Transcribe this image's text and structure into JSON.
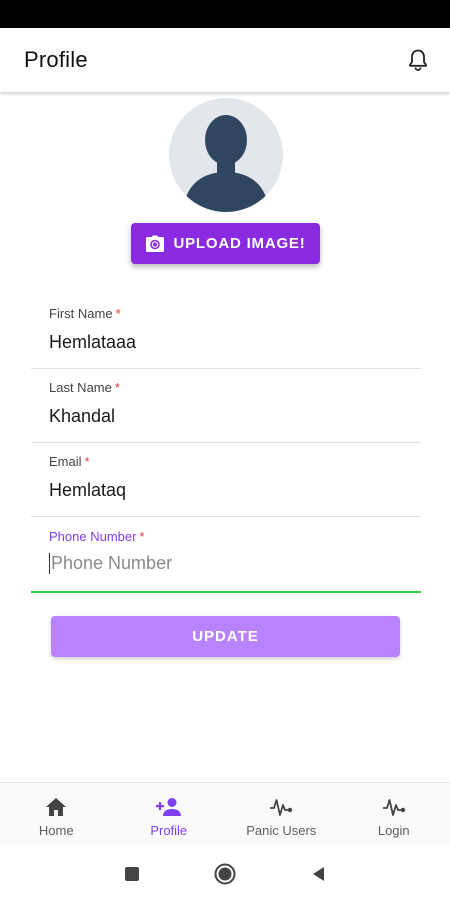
{
  "app_bar": {
    "title": "Profile",
    "notification_icon": "bell-icon"
  },
  "profile_image": {
    "icon": "avatar-placeholder-icon"
  },
  "upload_button": {
    "label": "UPLOAD IMAGE!",
    "icon": "camera-icon"
  },
  "form": {
    "required_mark": "*",
    "first_name": {
      "label": "First Name",
      "value": "Hemlataaa"
    },
    "last_name": {
      "label": "Last Name",
      "value": "Khandal"
    },
    "email": {
      "label": "Email",
      "value": "Hemlataq"
    },
    "phone": {
      "label": "Phone Number",
      "value": "",
      "placeholder": "Phone Number"
    }
  },
  "update_button": {
    "label": "UPDATE"
  },
  "bottom_nav": {
    "active": "Profile",
    "items": [
      {
        "label": "Home",
        "icon": "home-icon"
      },
      {
        "label": "Profile",
        "icon": "add-user-icon"
      },
      {
        "label": "Panic Users",
        "icon": "pulse-icon"
      },
      {
        "label": "Login",
        "icon": "pulse-icon"
      }
    ]
  },
  "system_nav": {
    "icons": [
      "recents-icon",
      "home-circle-icon",
      "back-icon"
    ]
  },
  "colors": {
    "primary": "#8a2be2",
    "primary_light": "#b983ff",
    "active_accent": "#7e3ff2",
    "focus_underline": "#2ecc40",
    "required": "#e53935",
    "avatar_bg": "#e3e6ea",
    "avatar_fg": "#2f4660"
  }
}
